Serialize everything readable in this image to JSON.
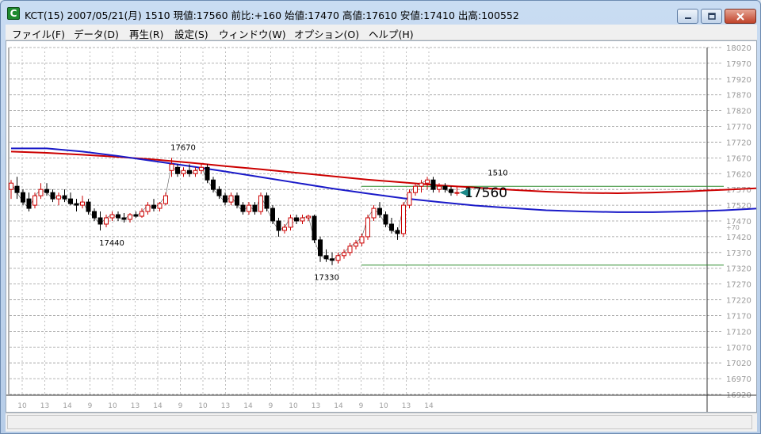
{
  "window": {
    "app_icon_letter": "C",
    "title": "KCT(15) 2007/05/21(月) 1510 現値:17560 前比:+160 始値:17470 高値:17610 安値:17410 出高:100552"
  },
  "menu": [
    {
      "label": "ファイル(F)"
    },
    {
      "label": "データ(D)"
    },
    {
      "label": "再生(R)"
    },
    {
      "label": "設定(S)"
    },
    {
      "label": "ウィンドウ(W)"
    },
    {
      "label": "オプション(O)"
    },
    {
      "label": "ヘルプ(H)"
    }
  ],
  "chart_data": {
    "type": "candlestick",
    "symbol": "KCT(15)",
    "grid": true,
    "ylim": [
      16920,
      18020
    ],
    "y_ticks": [
      18020,
      17970,
      17920,
      17870,
      17820,
      17770,
      17720,
      17670,
      17620,
      17570,
      17520,
      17470,
      17420,
      17370,
      17320,
      17270,
      17220,
      17170,
      17120,
      17070,
      17020,
      16970,
      16920
    ],
    "x_tick_labels": [
      "10",
      "13",
      "14",
      "9",
      "10",
      "13",
      "14",
      "9",
      "10",
      "13",
      "14",
      "9",
      "10",
      "13",
      "14",
      "9",
      "10",
      "13",
      "14"
    ],
    "candles": [
      {
        "o": 17570,
        "h": 17600,
        "l": 17540,
        "c": 17590
      },
      {
        "o": 17580,
        "h": 17610,
        "l": 17540,
        "c": 17560
      },
      {
        "o": 17560,
        "h": 17570,
        "l": 17520,
        "c": 17530
      },
      {
        "o": 17540,
        "h": 17560,
        "l": 17500,
        "c": 17510
      },
      {
        "o": 17520,
        "h": 17560,
        "l": 17510,
        "c": 17550
      },
      {
        "o": 17550,
        "h": 17590,
        "l": 17540,
        "c": 17570
      },
      {
        "o": 17570,
        "h": 17590,
        "l": 17550,
        "c": 17560
      },
      {
        "o": 17560,
        "h": 17570,
        "l": 17530,
        "c": 17540
      },
      {
        "o": 17540,
        "h": 17560,
        "l": 17520,
        "c": 17550
      },
      {
        "o": 17550,
        "h": 17570,
        "l": 17530,
        "c": 17540
      },
      {
        "o": 17540,
        "h": 17560,
        "l": 17520,
        "c": 17525
      },
      {
        "o": 17525,
        "h": 17540,
        "l": 17500,
        "c": 17520
      },
      {
        "o": 17520,
        "h": 17550,
        "l": 17510,
        "c": 17530
      },
      {
        "o": 17530,
        "h": 17540,
        "l": 17490,
        "c": 17500
      },
      {
        "o": 17500,
        "h": 17510,
        "l": 17470,
        "c": 17480
      },
      {
        "o": 17480,
        "h": 17500,
        "l": 17440,
        "c": 17460
      },
      {
        "o": 17460,
        "h": 17490,
        "l": 17450,
        "c": 17480
      },
      {
        "o": 17480,
        "h": 17500,
        "l": 17470,
        "c": 17490
      },
      {
        "o": 17490,
        "h": 17500,
        "l": 17470,
        "c": 17480
      },
      {
        "o": 17480,
        "h": 17495,
        "l": 17465,
        "c": 17475
      },
      {
        "o": 17475,
        "h": 17495,
        "l": 17465,
        "c": 17490
      },
      {
        "o": 17490,
        "h": 17500,
        "l": 17480,
        "c": 17485
      },
      {
        "o": 17485,
        "h": 17510,
        "l": 17480,
        "c": 17500
      },
      {
        "o": 17500,
        "h": 17530,
        "l": 17490,
        "c": 17520
      },
      {
        "o": 17520,
        "h": 17540,
        "l": 17500,
        "c": 17510
      },
      {
        "o": 17510,
        "h": 17530,
        "l": 17500,
        "c": 17525
      },
      {
        "o": 17525,
        "h": 17560,
        "l": 17520,
        "c": 17550
      },
      {
        "o": 17630,
        "h": 17670,
        "l": 17610,
        "c": 17650
      },
      {
        "o": 17640,
        "h": 17650,
        "l": 17610,
        "c": 17620
      },
      {
        "o": 17620,
        "h": 17640,
        "l": 17610,
        "c": 17630
      },
      {
        "o": 17630,
        "h": 17650,
        "l": 17610,
        "c": 17620
      },
      {
        "o": 17620,
        "h": 17640,
        "l": 17610,
        "c": 17630
      },
      {
        "o": 17630,
        "h": 17650,
        "l": 17620,
        "c": 17640
      },
      {
        "o": 17640,
        "h": 17650,
        "l": 17590,
        "c": 17600
      },
      {
        "o": 17600,
        "h": 17610,
        "l": 17560,
        "c": 17570
      },
      {
        "o": 17570,
        "h": 17580,
        "l": 17540,
        "c": 17550
      },
      {
        "o": 17550,
        "h": 17560,
        "l": 17520,
        "c": 17530
      },
      {
        "o": 17530,
        "h": 17560,
        "l": 17520,
        "c": 17550
      },
      {
        "o": 17550,
        "h": 17560,
        "l": 17510,
        "c": 17520
      },
      {
        "o": 17520,
        "h": 17530,
        "l": 17490,
        "c": 17500
      },
      {
        "o": 17500,
        "h": 17530,
        "l": 17490,
        "c": 17520
      },
      {
        "o": 17520,
        "h": 17530,
        "l": 17490,
        "c": 17500
      },
      {
        "o": 17500,
        "h": 17560,
        "l": 17490,
        "c": 17550
      },
      {
        "o": 17550,
        "h": 17560,
        "l": 17500,
        "c": 17510
      },
      {
        "o": 17510,
        "h": 17520,
        "l": 17460,
        "c": 17470
      },
      {
        "o": 17470,
        "h": 17480,
        "l": 17420,
        "c": 17440
      },
      {
        "o": 17440,
        "h": 17460,
        "l": 17430,
        "c": 17450
      },
      {
        "o": 17450,
        "h": 17490,
        "l": 17440,
        "c": 17480
      },
      {
        "o": 17480,
        "h": 17490,
        "l": 17460,
        "c": 17470
      },
      {
        "o": 17470,
        "h": 17490,
        "l": 17460,
        "c": 17480
      },
      {
        "o": 17480,
        "h": 17490,
        "l": 17470,
        "c": 17485
      },
      {
        "o": 17485,
        "h": 17490,
        "l": 17400,
        "c": 17410
      },
      {
        "o": 17410,
        "h": 17420,
        "l": 17340,
        "c": 17360
      },
      {
        "o": 17360,
        "h": 17380,
        "l": 17340,
        "c": 17350
      },
      {
        "o": 17350,
        "h": 17370,
        "l": 17330,
        "c": 17345
      },
      {
        "o": 17345,
        "h": 17370,
        "l": 17335,
        "c": 17360
      },
      {
        "o": 17360,
        "h": 17380,
        "l": 17350,
        "c": 17370
      },
      {
        "o": 17370,
        "h": 17400,
        "l": 17360,
        "c": 17390
      },
      {
        "o": 17390,
        "h": 17410,
        "l": 17380,
        "c": 17400
      },
      {
        "o": 17400,
        "h": 17430,
        "l": 17390,
        "c": 17420
      },
      {
        "o": 17420,
        "h": 17490,
        "l": 17410,
        "c": 17480
      },
      {
        "o": 17480,
        "h": 17520,
        "l": 17470,
        "c": 17510
      },
      {
        "o": 17510,
        "h": 17530,
        "l": 17480,
        "c": 17490
      },
      {
        "o": 17490,
        "h": 17500,
        "l": 17450,
        "c": 17460
      },
      {
        "o": 17460,
        "h": 17480,
        "l": 17430,
        "c": 17440
      },
      {
        "o": 17440,
        "h": 17450,
        "l": 17410,
        "c": 17430
      },
      {
        "o": 17430,
        "h": 17530,
        "l": 17420,
        "c": 17520
      },
      {
        "o": 17520,
        "h": 17570,
        "l": 17510,
        "c": 17560
      },
      {
        "o": 17560,
        "h": 17590,
        "l": 17550,
        "c": 17580
      },
      {
        "o": 17580,
        "h": 17600,
        "l": 17560,
        "c": 17590
      },
      {
        "o": 17590,
        "h": 17610,
        "l": 17570,
        "c": 17600
      },
      {
        "o": 17600,
        "h": 17610,
        "l": 17560,
        "c": 17570
      },
      {
        "o": 17570,
        "h": 17590,
        "l": 17560,
        "c": 17580
      },
      {
        "o": 17580,
        "h": 17590,
        "l": 17560,
        "c": 17570
      },
      {
        "o": 17570,
        "h": 17580,
        "l": 17550,
        "c": 17560
      },
      {
        "o": 17560,
        "h": 17580,
        "l": 17550,
        "c": 17560
      }
    ],
    "moving_averages": [
      {
        "color": "#cc0000",
        "x_start": 0,
        "x_step": 6,
        "values": [
          17690,
          17686,
          17680,
          17673,
          17665,
          17655,
          17644,
          17634,
          17623,
          17612,
          17601,
          17592,
          17583,
          17576,
          17569,
          17563,
          17559,
          17558,
          17560,
          17564,
          17569,
          17574,
          17578,
          17581,
          17583,
          17585,
          17586,
          17585,
          17582,
          17577,
          17570,
          17563,
          17555,
          17547,
          17540,
          17534,
          17528,
          17522,
          17516,
          17511,
          17508,
          17507,
          17507,
          17508,
          17510,
          17512,
          17513
        ]
      },
      {
        "color": "#1a1ac8",
        "x_start": 0,
        "x_step": 6,
        "values": [
          17700,
          17700,
          17690,
          17676,
          17660,
          17644,
          17627,
          17609,
          17591,
          17573,
          17557,
          17542,
          17530,
          17519,
          17511,
          17504,
          17500,
          17498,
          17498,
          17500,
          17504,
          17510,
          17516,
          17523,
          17532,
          17543,
          17554,
          17563,
          17570,
          17573,
          17572,
          17570,
          17567,
          17563,
          17557,
          17550,
          17542,
          17533,
          17522,
          17509,
          17494,
          17478,
          17464,
          17452,
          17443,
          17437,
          17433,
          17430,
          17428,
          17427,
          17426,
          17424,
          17424,
          17429,
          17438,
          17452,
          17470,
          17491
        ]
      }
    ],
    "annotations": [
      {
        "label": "17670",
        "value": 17670
      },
      {
        "label": "17440",
        "value": 17440
      },
      {
        "label": "17330",
        "value": 17330
      },
      {
        "label": "1510",
        "value": 17610
      }
    ],
    "horizontal_lines": [
      17580,
      17330
    ],
    "current_price": {
      "label": "17560",
      "value": 17560
    },
    "change_label": "+70"
  }
}
